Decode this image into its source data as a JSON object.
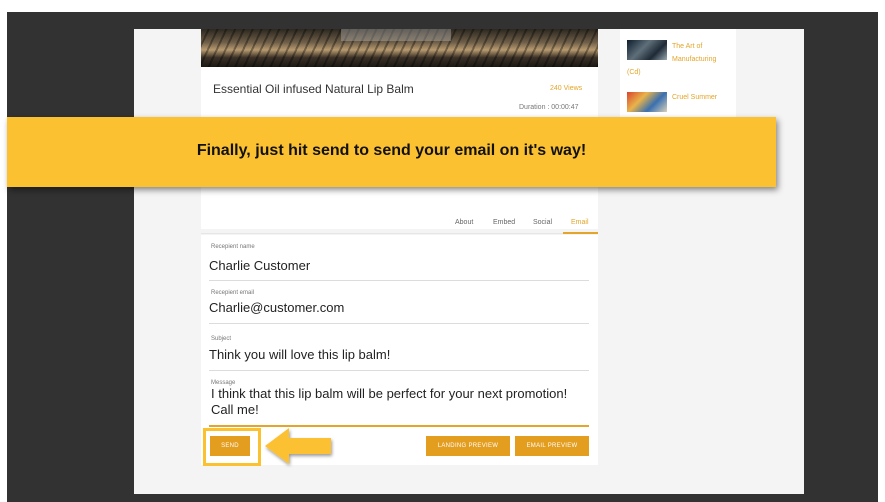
{
  "colors": {
    "accent": "#e3a52a",
    "banner": "#fcc130",
    "button": "#e39d1f"
  },
  "video": {
    "title": "Essential Oil infused Natural Lip Balm",
    "views": "240 Views",
    "duration": "Duration : 00:00:47"
  },
  "sidebar": {
    "items": [
      {
        "title_line1": "The Art of",
        "title_line2": "Manufacturing",
        "title_line3": "(Cd)"
      },
      {
        "title_line1": "Cruel Summer"
      }
    ]
  },
  "banner": {
    "text": "Finally, just hit send to send your email on it's way!"
  },
  "tabs": [
    {
      "label": "About"
    },
    {
      "label": "Embed"
    },
    {
      "label": "Social"
    },
    {
      "label": "Email"
    }
  ],
  "form": {
    "recipient_name": {
      "label": "Recepient name",
      "value": "Charlie Customer"
    },
    "recipient_email": {
      "label": "Recepient email",
      "value": "Charlie@customer.com"
    },
    "subject": {
      "label": "Subject",
      "value": "Think you will love this lip balm!"
    },
    "message": {
      "label": "Message",
      "value": "I think that this lip balm will be perfect for your next promotion! Call me!"
    }
  },
  "buttons": {
    "send": "SEND",
    "landing_preview": "LANDING PREVIEW",
    "email_preview": "EMAIL PREVIEW"
  }
}
